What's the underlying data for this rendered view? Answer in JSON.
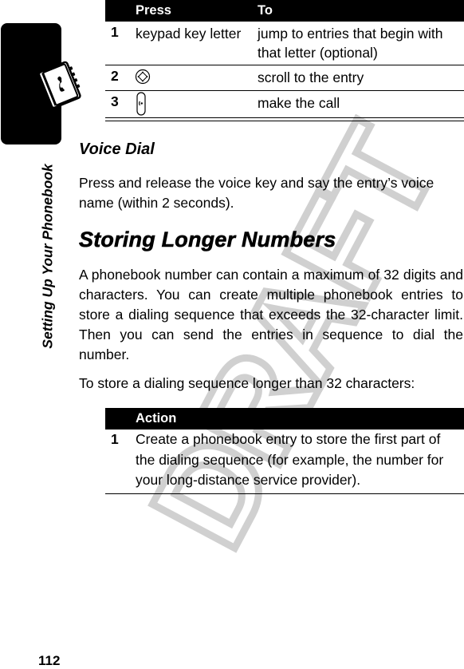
{
  "sidebar": {
    "section_title": "Setting Up Your Phonebook",
    "icon": "phonebook-icon"
  },
  "steps_table": {
    "headers": [
      "Press",
      "To"
    ],
    "rows": [
      {
        "num": "1",
        "press": "keypad key letter",
        "press_icon": null,
        "to": "jump to entries that begin with that letter (optional)"
      },
      {
        "num": "2",
        "press": "",
        "press_icon": "navigation-key-icon",
        "to": "scroll to the entry"
      },
      {
        "num": "3",
        "press": "",
        "press_icon": "send-key-icon",
        "to": "make the call"
      }
    ]
  },
  "voice_dial": {
    "heading": "Voice Dial",
    "body": "Press and release the voice key and say the entry’s voice name (within 2 seconds)."
  },
  "storing": {
    "heading": "Storing Longer Numbers",
    "body": "A phonebook number can contain a maximum of 32 digits and characters. You can create multiple phonebook entries to store a dialing sequence that exceeds the 32-character limit. Then you can send the entries in sequence to dial the number.",
    "intro": "To store a dialing sequence longer than 32 characters:"
  },
  "action_table": {
    "header": "Action",
    "rows": [
      {
        "num": "1",
        "action": "Create a phonebook entry to store the first part of the dialing sequence (for example, the number for your long-distance service provider)."
      }
    ]
  },
  "watermark": "DRAFT",
  "page_number": "112"
}
